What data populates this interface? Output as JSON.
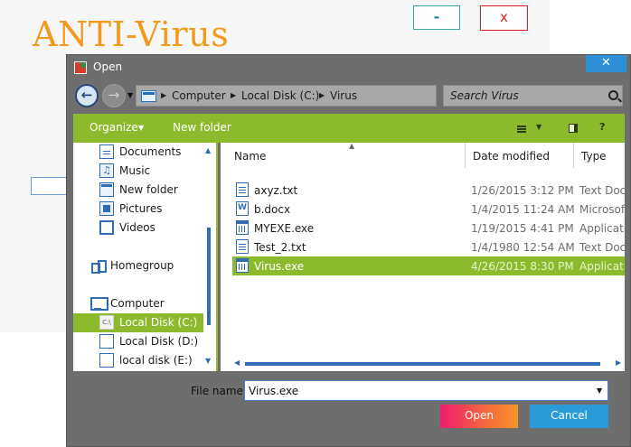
{
  "app": {
    "title": "ANTI-Virus",
    "minimize_label": "-",
    "close_label": "x"
  },
  "dialog": {
    "title": "Open",
    "close_label": "✕",
    "address": {
      "segments": [
        "Computer",
        "Local Disk (C:)",
        "Virus"
      ]
    },
    "search": {
      "placeholder": "Search Virus"
    },
    "toolbar": {
      "organize_label": "Organize",
      "new_folder_label": "New folder"
    },
    "nav_pane": {
      "items": [
        {
          "label": "Documents",
          "icon": "documents-icon"
        },
        {
          "label": "Music",
          "icon": "music-icon"
        },
        {
          "label": "New folder",
          "icon": "folder-icon"
        },
        {
          "label": "Pictures",
          "icon": "pictures-icon"
        },
        {
          "label": "Videos",
          "icon": "videos-icon"
        },
        {
          "label": "Homegroup",
          "icon": "homegroup-icon"
        },
        {
          "label": "Computer",
          "icon": "computer-icon"
        },
        {
          "label": "Local Disk (C:)",
          "icon": "drive-c-icon",
          "selected": true
        },
        {
          "label": "Local Disk (D:)",
          "icon": "drive-icon"
        },
        {
          "label": "local disk (E:)",
          "icon": "drive-icon"
        }
      ]
    },
    "file_list": {
      "columns": [
        "Name",
        "Date modified",
        "Type"
      ],
      "rows": [
        {
          "name": "axyz.txt",
          "date": "1/26/2015 3:12 PM",
          "type": "Text Docu",
          "icon": "text-file-icon"
        },
        {
          "name": "b.docx",
          "date": "1/4/2015 11:24 AM",
          "type": "Microsoft",
          "icon": "word-file-icon"
        },
        {
          "name": "MYEXE.exe",
          "date": "1/19/2015 4:41 PM",
          "type": "Applicatio",
          "icon": "exe-file-icon"
        },
        {
          "name": "Test_2.txt",
          "date": "1/4/1980 12:54 AM",
          "type": "Text Docu",
          "icon": "text-file-icon"
        },
        {
          "name": "Virus.exe",
          "date": "4/26/2015 8:30 PM",
          "type": "Applicatio",
          "icon": "exe-file-icon",
          "selected": true
        }
      ]
    },
    "file_name": {
      "label": "File name:",
      "value": "Virus.exe"
    },
    "buttons": {
      "open_label": "Open",
      "cancel_label": "Cancel"
    }
  },
  "colors": {
    "accent_green": "#8dba2c",
    "title_orange": "#f39a1e",
    "dialog_gray": "#6e6e6e",
    "cancel_blue": "#2a9ad8",
    "open_gradient_start": "#ee1b6e",
    "open_gradient_end": "#f7942a"
  }
}
